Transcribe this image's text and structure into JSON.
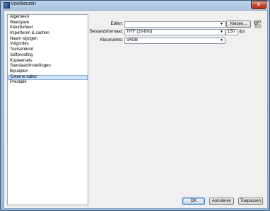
{
  "window": {
    "title": "Voorkeuren",
    "close": "x"
  },
  "categories": [
    {
      "label": "Algemeen",
      "selected": false
    },
    {
      "label": "Weergave",
      "selected": false
    },
    {
      "label": "Kleurbeheer",
      "selected": false
    },
    {
      "label": "Importeren & cachen",
      "selected": false
    },
    {
      "label": "Naam wijzigen",
      "selected": false
    },
    {
      "label": "Volgordes",
      "selected": false
    },
    {
      "label": "Toetsenbord",
      "selected": false
    },
    {
      "label": "Softproofing",
      "selected": false
    },
    {
      "label": "Kopieersets",
      "selected": false
    },
    {
      "label": "Standaardinstellingen",
      "selected": false
    },
    {
      "label": "Bijsnijden",
      "selected": false
    },
    {
      "label": "Externe editor",
      "selected": true
    },
    {
      "label": "Prestatie",
      "selected": false
    }
  ],
  "editor": {
    "label": "Editor:",
    "value": "",
    "choose_label": "Kiezen..."
  },
  "file_format": {
    "label": "Bestandsformaat:",
    "value": "TIFF (16-bits)",
    "dpi_value": "150",
    "dpi_unit": "dpi"
  },
  "color_space": {
    "label": "Kleurruimte:",
    "value": "sRGB"
  },
  "buttons": {
    "ok": "OK",
    "cancel": "Annuleren",
    "apply": "Toepassen"
  },
  "icons": {
    "dropdown": "▼"
  }
}
